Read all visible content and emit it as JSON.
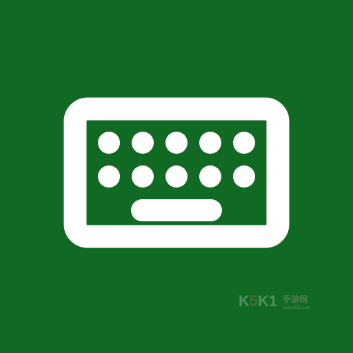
{
  "app_icon": {
    "icon": "keyboard-icon",
    "background_color": "#116a23",
    "foreground_color": "#ffffff"
  },
  "watermark": {
    "brand_k1": "K",
    "brand_5": "5",
    "brand_k2": "K1",
    "site_name": "手游网",
    "url": "www.k5k1.com"
  }
}
